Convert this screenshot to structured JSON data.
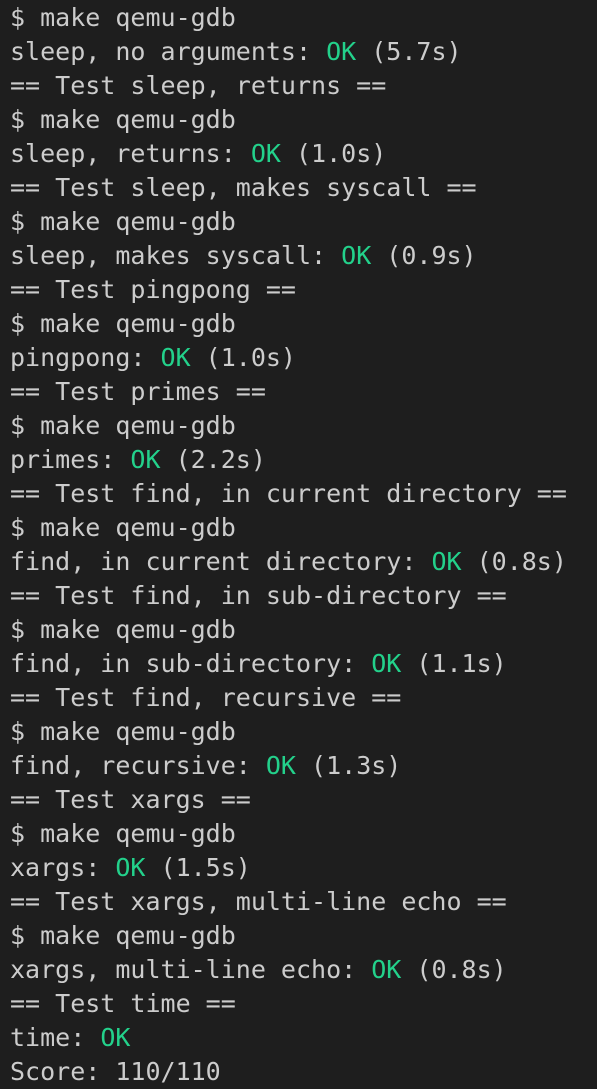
{
  "terminal": {
    "lines": [
      {
        "kind": "cmd",
        "text": "$ make qemu-gdb"
      },
      {
        "kind": "result",
        "label": "sleep, no arguments: ",
        "status": "OK",
        "time": " (5.7s)"
      },
      {
        "kind": "header",
        "text": "== Test sleep, returns =="
      },
      {
        "kind": "cmd",
        "text": "$ make qemu-gdb"
      },
      {
        "kind": "result",
        "label": "sleep, returns: ",
        "status": "OK",
        "time": " (1.0s)"
      },
      {
        "kind": "header",
        "text": "== Test sleep, makes syscall =="
      },
      {
        "kind": "cmd",
        "text": "$ make qemu-gdb"
      },
      {
        "kind": "result",
        "label": "sleep, makes syscall: ",
        "status": "OK",
        "time": " (0.9s)"
      },
      {
        "kind": "header",
        "text": "== Test pingpong =="
      },
      {
        "kind": "cmd",
        "text": "$ make qemu-gdb"
      },
      {
        "kind": "result",
        "label": "pingpong: ",
        "status": "OK",
        "time": " (1.0s)"
      },
      {
        "kind": "header",
        "text": "== Test primes =="
      },
      {
        "kind": "cmd",
        "text": "$ make qemu-gdb"
      },
      {
        "kind": "result",
        "label": "primes: ",
        "status": "OK",
        "time": " (2.2s)"
      },
      {
        "kind": "header",
        "text": "== Test find, in current directory =="
      },
      {
        "kind": "cmd",
        "text": "$ make qemu-gdb"
      },
      {
        "kind": "result",
        "label": "find, in current directory: ",
        "status": "OK",
        "time": " (0.8s)"
      },
      {
        "kind": "header",
        "text": "== Test find, in sub-directory =="
      },
      {
        "kind": "cmd",
        "text": "$ make qemu-gdb"
      },
      {
        "kind": "result",
        "label": "find, in sub-directory: ",
        "status": "OK",
        "time": " (1.1s)"
      },
      {
        "kind": "header",
        "text": "== Test find, recursive =="
      },
      {
        "kind": "cmd",
        "text": "$ make qemu-gdb"
      },
      {
        "kind": "result",
        "label": "find, recursive: ",
        "status": "OK",
        "time": " (1.3s)"
      },
      {
        "kind": "header",
        "text": "== Test xargs =="
      },
      {
        "kind": "cmd",
        "text": "$ make qemu-gdb"
      },
      {
        "kind": "result",
        "label": "xargs: ",
        "status": "OK",
        "time": " (1.5s)"
      },
      {
        "kind": "header",
        "text": "== Test xargs, multi-line echo =="
      },
      {
        "kind": "cmd",
        "text": "$ make qemu-gdb"
      },
      {
        "kind": "result",
        "label": "xargs, multi-line echo: ",
        "status": "OK",
        "time": " (0.8s)"
      },
      {
        "kind": "header",
        "text": "== Test time =="
      },
      {
        "kind": "result",
        "label": "time: ",
        "status": "OK",
        "time": ""
      },
      {
        "kind": "score",
        "text": "Score: 110/110"
      }
    ]
  },
  "colors": {
    "background": "#1e1e1e",
    "foreground": "#cccccc",
    "ok": "#23d18b"
  }
}
